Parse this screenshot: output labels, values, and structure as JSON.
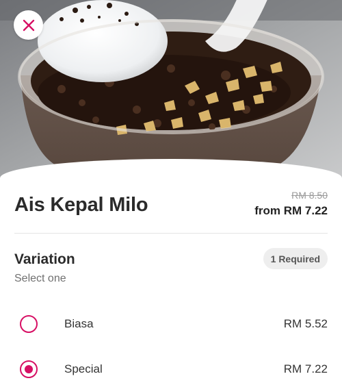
{
  "colors": {
    "accent": "#d70f64",
    "text": "#2b2b2b",
    "muted": "#707070",
    "badge_bg": "#eeeeee"
  },
  "header": {
    "close_icon": "close-icon"
  },
  "product": {
    "name": "Ais Kepal Milo",
    "old_price": "RM 8.50",
    "from_price": "from RM 7.22"
  },
  "variation": {
    "title": "Variation",
    "subtitle": "Select one",
    "required_badge": "1 Required",
    "options": [
      {
        "label": "Biasa",
        "price": "RM 5.52",
        "selected": false
      },
      {
        "label": "Special",
        "price": "RM 7.22",
        "selected": true
      }
    ]
  }
}
